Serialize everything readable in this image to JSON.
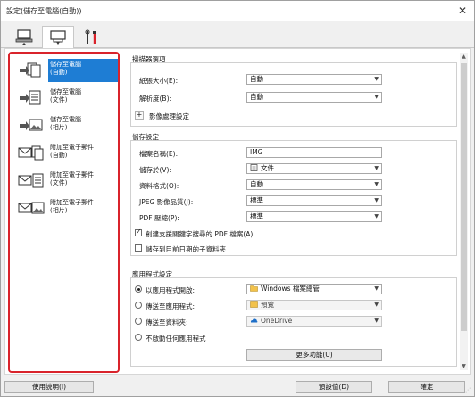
{
  "window": {
    "title": "設定(儲存至電腦(自動))"
  },
  "tabs": [
    {
      "name": "scan-from-computer"
    },
    {
      "name": "scan-from-operation-panel"
    },
    {
      "name": "general-settings"
    }
  ],
  "left_list": [
    {
      "l1": "儲存至電腦",
      "l2": "(自動)",
      "icon": "save-auto-icon",
      "selected": true
    },
    {
      "l1": "儲存至電腦",
      "l2": "(文件)",
      "icon": "save-document-icon"
    },
    {
      "l1": "儲存至電腦",
      "l2": "(相片)",
      "icon": "save-photo-icon"
    },
    {
      "l1": "附加至電子郵件",
      "l2": "(自動)",
      "icon": "email-auto-icon"
    },
    {
      "l1": "附加至電子郵件",
      "l2": "(文件)",
      "icon": "email-document-icon"
    },
    {
      "l1": "附加至電子郵件",
      "l2": "(相片)",
      "icon": "email-photo-icon"
    }
  ],
  "scanner_options": {
    "header": "掃描器選項",
    "paper_size": {
      "label": "紙張大小(E):",
      "value": "自動"
    },
    "resolution": {
      "label": "解析度(B):",
      "value": "自動"
    },
    "image_processing": "影像處理設定"
  },
  "save_settings": {
    "header": "儲存設定",
    "file_name": {
      "label": "檔案名稱(E):",
      "value": "IMG"
    },
    "save_in": {
      "label": "儲存於(V):",
      "value": "文件"
    },
    "data_format": {
      "label": "資料格式(O):",
      "value": "自動"
    },
    "jpeg_quality": {
      "label": "JPEG 影像品質(J):",
      "value": "標準"
    },
    "pdf_compression": {
      "label": "PDF 壓縮(P):",
      "value": "標準"
    },
    "create_searchable_pdf": "創建支援關鍵字搜尋的 PDF 檔案(A)",
    "save_to_date_subfolder": "儲存到目前日期的子資料夾"
  },
  "app_settings": {
    "header": "應用程式設定",
    "open_with_app": {
      "label": "以應用程式開啟:",
      "value": "Windows 檔案總管"
    },
    "send_to_app": {
      "label": "傳送至應用程式:",
      "value": "預覽"
    },
    "send_to_folder": {
      "label": "傳送至資料夾:",
      "value": "OneDrive"
    },
    "do_not_start": "不啟動任何應用程式",
    "more_functions": "更多功能(U)"
  },
  "bottom": {
    "help": "使用說明(I)",
    "defaults": "預設值(D)",
    "ok": "確定"
  },
  "colors": {
    "selection": "#1e7dd4",
    "highlight_border": "#d9232b"
  }
}
